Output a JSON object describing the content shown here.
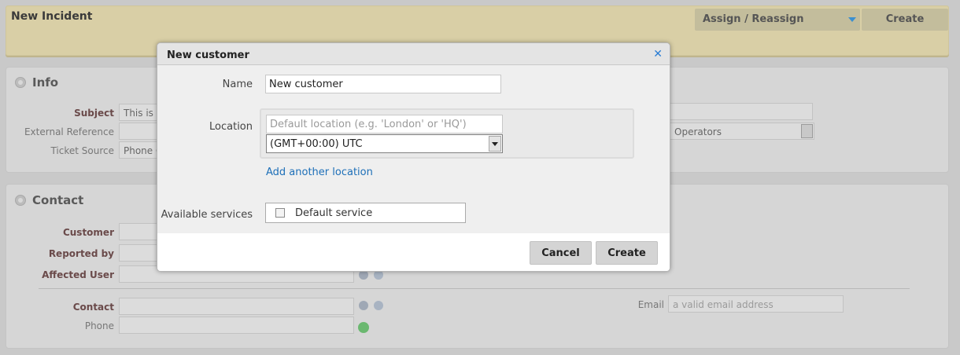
{
  "header": {
    "title": "New Incident",
    "assign_label": "Assign / Reassign",
    "create_label": "Create"
  },
  "info": {
    "title": "Info",
    "subject_label": "Subject",
    "subject_value": "This is a",
    "external_ref_label": "External Reference",
    "ticket_source_label": "Ticket Source",
    "ticket_source_value": "Phone C",
    "operators_value": "Operators"
  },
  "contact": {
    "title": "Contact",
    "customer_label": "Customer",
    "reported_by_label": "Reported by",
    "affected_user_label": "Affected User",
    "contact_label": "Contact",
    "phone_label": "Phone",
    "email_label": "Email",
    "email_placeholder": "a valid email address"
  },
  "dialog": {
    "title": "New customer",
    "name_label": "Name",
    "name_value": "New customer",
    "location_label": "Location",
    "location_placeholder": "Default location (e.g. 'London' or 'HQ')",
    "timezone_value": "(GMT+00:00) UTC",
    "add_location_link": "Add another location",
    "services_label": "Available services",
    "service_default": "Default service",
    "cancel_label": "Cancel",
    "create_label": "Create"
  },
  "colors": {
    "link": "#1d6fb8",
    "close": "#2a7dd4",
    "header_bg": "#d9cfa6"
  }
}
